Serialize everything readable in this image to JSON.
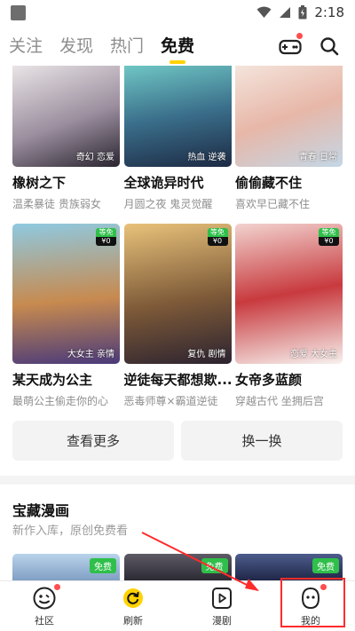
{
  "status_bar": {
    "time": "2:18"
  },
  "top_nav": {
    "tabs": [
      {
        "label": "关注",
        "active": false
      },
      {
        "label": "发现",
        "active": false
      },
      {
        "label": "热门",
        "active": false
      },
      {
        "label": "免费",
        "active": true
      }
    ],
    "icons": [
      "gamepad-icon",
      "search-icon"
    ]
  },
  "comics_row1": [
    {
      "title": "橡树之下",
      "subtitle": "温柔暴徒 贵族弱女",
      "tag": "奇幻 恋爱",
      "colors": [
        "#e9e4e6",
        "#9b8e9e",
        "#2a2530"
      ]
    },
    {
      "title": "全球诡异时代",
      "subtitle": "月圆之夜 鬼灵觉醒",
      "tag": "热血 逆袭",
      "colors": [
        "#6fc6c4",
        "#3a6e8a",
        "#1d2a44"
      ]
    },
    {
      "title": "偷偷藏不住",
      "subtitle": "喜欢早已藏不住",
      "tag": "青春 日常",
      "colors": [
        "#f4e4dc",
        "#e7b7a8",
        "#c4d7e6"
      ]
    }
  ],
  "comics_row2": [
    {
      "title": "某天成为公主",
      "subtitle": "最萌公主偷走你的心",
      "tag": "大女主 亲情",
      "badge_top": "等免",
      "badge_bottom": "¥0",
      "colors": [
        "#8fc9e0",
        "#c78a4f",
        "#4a3a7a"
      ]
    },
    {
      "title": "逆徒每天都想欺...",
      "subtitle": "恶毒师尊×霸道逆徒",
      "tag": "复仇 剧情",
      "badge_top": "等免",
      "badge_bottom": "¥0",
      "colors": [
        "#e8c27a",
        "#7e5a38",
        "#2c2330"
      ]
    },
    {
      "title": "女帝多蓝颜",
      "subtitle": "穿越古代 坐拥后宫",
      "tag": "恋爱 大女主",
      "badge_top": "等免",
      "badge_bottom": "¥0",
      "colors": [
        "#f2d3cf",
        "#c83a3e",
        "#f7f1ee"
      ]
    }
  ],
  "actions": {
    "more": "查看更多",
    "refresh": "换一换"
  },
  "section": {
    "title": "宝藏漫画",
    "subtitle": "新作入库，原创免费看"
  },
  "treasure": [
    {
      "badge": "免费",
      "colors": [
        "#b9d3ea",
        "#7f9fc4"
      ]
    },
    {
      "badge": "免费",
      "colors": [
        "#5e5a66",
        "#2b2a33"
      ]
    },
    {
      "badge": "免费",
      "colors": [
        "#4d5c8c",
        "#1f2748"
      ]
    }
  ],
  "bottom_nav": [
    {
      "label": "社区",
      "icon": "community-face-icon",
      "dot": true
    },
    {
      "label": "刷新",
      "icon": "refresh-icon",
      "dot": false
    },
    {
      "label": "漫剧",
      "icon": "play-icon",
      "dot": false
    },
    {
      "label": "我的",
      "icon": "profile-icon",
      "dot": true
    }
  ],
  "accent_colors": {
    "brand_yellow": "#ffd200",
    "badge_green": "#2fbf4a",
    "annotation_red": "#ff2b2b"
  }
}
